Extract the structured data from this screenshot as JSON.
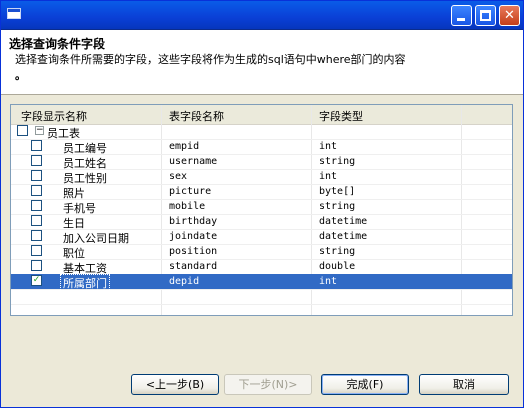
{
  "header": {
    "title": "选择查询条件字段",
    "description": "选择查询条件所需要的字段，这些字段将作为生成的sql语句中where部门的内容",
    "description_tail": "。"
  },
  "table": {
    "columns": [
      "字段显示名称",
      "表字段名称",
      "字段类型"
    ],
    "parent": {
      "label": "员工表",
      "checked": false,
      "expander": "−"
    },
    "rows": [
      {
        "display": "员工编号",
        "field": "empid",
        "type": "int",
        "checked": false
      },
      {
        "display": "员工姓名",
        "field": "username",
        "type": "string",
        "checked": false
      },
      {
        "display": "员工性别",
        "field": "sex",
        "type": "int",
        "checked": false
      },
      {
        "display": "照片",
        "field": "picture",
        "type": "byte[]",
        "checked": false
      },
      {
        "display": "手机号",
        "field": "mobile",
        "type": "string",
        "checked": false
      },
      {
        "display": "生日",
        "field": "birthday",
        "type": "datetime",
        "checked": false
      },
      {
        "display": "加入公司日期",
        "field": "joindate",
        "type": "datetime",
        "checked": false
      },
      {
        "display": "职位",
        "field": "position",
        "type": "string",
        "checked": false
      },
      {
        "display": "基本工资",
        "field": "standard",
        "type": "double",
        "checked": false
      },
      {
        "display": "所属部门",
        "field": "depid",
        "type": "int",
        "checked": true,
        "selected": true
      }
    ]
  },
  "buttons": {
    "back": "<上一步(B)",
    "next": "下一步(N)>",
    "finish": "完成(F)",
    "cancel": "取消"
  },
  "colors": {
    "selection": "#316ac5",
    "titlebar": "#0a5ce8"
  }
}
